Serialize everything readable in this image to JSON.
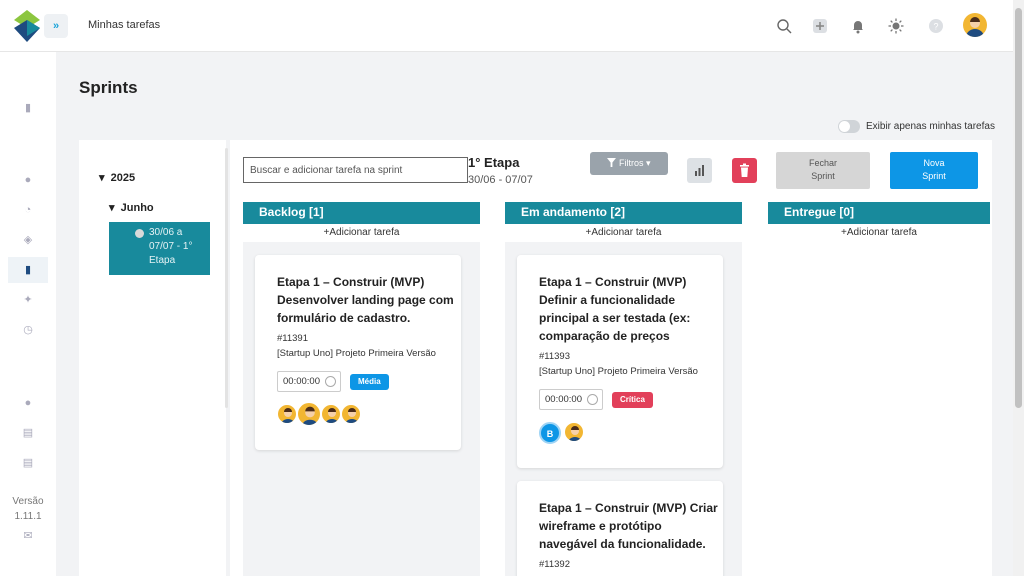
{
  "topbar": {
    "title": "Minhas tarefas",
    "collapse_icon": "»"
  },
  "nav": {
    "version_label": "Versão",
    "version_number": "1.11.1"
  },
  "page": {
    "title": "Sprints"
  },
  "toggle": {
    "label": "Exibir apenas minhas tarefas"
  },
  "tree": {
    "year": "2025",
    "month": "Junho",
    "sprint_label": "30/06 a 07/07 - 1° Etapa"
  },
  "toolbar": {
    "search_placeholder": "Buscar e adicionar tarefa na sprint",
    "sprint_title": "1° Etapa",
    "sprint_dates": "30/06 - 07/07",
    "filter_label": "Filtros",
    "close_label": "Fechar Sprint",
    "new_label": "Nova Sprint"
  },
  "columns": [
    {
      "title": "Backlog [1]",
      "add_label": "+Adicionar tarefa"
    },
    {
      "title": "Em andamento [2]",
      "add_label": "+Adicionar tarefa"
    },
    {
      "title": "Entregue [0]",
      "add_label": "+Adicionar tarefa"
    }
  ],
  "cards": [
    {
      "title": "Etapa 1 – Construir (MVP) Desenvolver landing page com formulário de cadastro.",
      "id": "#11391",
      "project": "[Startup Uno] Projeto Primeira Versão",
      "timer": "00:00:00",
      "priority": "Média",
      "priority_color": "#0d96e6"
    },
    {
      "title": "Etapa 1 – Construir (MVP) Definir a funcionalidade principal a ser testada (ex: comparação de preços",
      "id": "#11393",
      "project": "[Startup Uno] Projeto Primeira Versão",
      "timer": "00:00:00",
      "priority": "Crítica",
      "priority_color": "#e2405a",
      "avatar_letter": "B"
    },
    {
      "title": "Etapa 1 – Construir (MVP) Criar wireframe e protótipo navegável da funcionalidade.",
      "id": "#11392"
    }
  ],
  "colors": {
    "accent": "#188a9c",
    "primary": "#0d96e6",
    "danger": "#e2405a"
  }
}
